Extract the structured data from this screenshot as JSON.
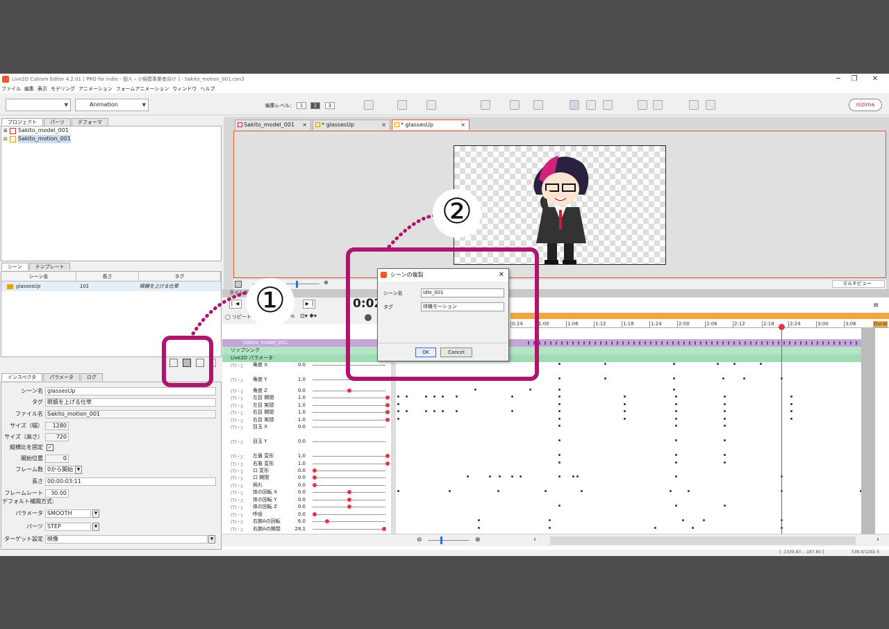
{
  "window": {
    "title": "Live2D Cubism Editor 4.2.01  [ PRO for indie - 個人・小規模事業者向け ] - Sakito_motion_001.can3",
    "min": "─",
    "max": "❐",
    "close": "✕"
  },
  "menu": [
    "ファイル",
    "編集",
    "表示",
    "モデリング",
    "アニメーション",
    "フォームアニメーション",
    "ウィンドウ",
    "ヘルプ"
  ],
  "toolbar": {
    "mode": "Animation",
    "edit_level_label": "編集レベル：",
    "levels": [
      "1",
      "2",
      "3"
    ],
    "brand": "nizima"
  },
  "project_panel": {
    "tabs": [
      "プロジェクト",
      "パーツ",
      "デフォーマ"
    ],
    "items": [
      "Sakito_model_001",
      "Sakito_motion_001"
    ]
  },
  "scene_panel": {
    "tabs": [
      "シーン",
      "テンプレート"
    ],
    "columns": [
      "シーン名",
      "長さ",
      "タグ"
    ],
    "rows": [
      {
        "name": "glassesUp",
        "length": "101",
        "tag": "眼鏡を上げる仕草"
      }
    ]
  },
  "inspector": {
    "tabs": [
      "インスペクタ",
      "パラメータ",
      "ログ"
    ],
    "scene_name_label": "シーン名",
    "scene_name": "glassesUp",
    "tag_label": "タグ",
    "tag": "眼鏡を上げる仕草",
    "file_label": "ファイル名",
    "file": "Sakito_motion_001",
    "width_label": "サイズ（幅）",
    "width": "1280",
    "height_label": "サイズ（高さ）",
    "height": "720",
    "aspect_label": "縦横比を固定",
    "start_label": "開始位置",
    "start": "0",
    "frame_label": "フレーム数",
    "frame": "0から開始",
    "length_label": "長さ",
    "length": "00:00:03:11",
    "fps_label": "フレームレート",
    "fps": "30.00",
    "interp_label": "デフォルト補間方式:",
    "param_label": "パラメータ",
    "param_interp": "SMOOTH",
    "parts_label": "パーツ",
    "parts_interp": "STEP",
    "target_label": "ターゲット設定",
    "target": "映像"
  },
  "doc_tabs": [
    {
      "label": "Sakito_model_001"
    },
    {
      "label": "* glassesUp"
    },
    {
      "label": "* glassesUp"
    }
  ],
  "canvas": {
    "view_label": "マルチビュー"
  },
  "timeline": {
    "tab": "タイムライン",
    "time": "0:02",
    "sub": "0",
    "repeat": "リピート",
    "speed": "100%",
    "ruler": [
      "0:24",
      "1:00",
      "1:06",
      "1:12",
      "1:18",
      "1:24",
      "2:00",
      "2:06",
      "2:12",
      "2:18",
      "2:24",
      "3:00",
      "3:06"
    ],
    "duration": "Durat",
    "model_row": "Sakito_model_001",
    "lipsync": "リップシンク",
    "params_row": "Live2D パラメータ",
    "params": [
      {
        "name": "角度 X",
        "value": "0.0"
      },
      {
        "name": "角度 Y",
        "value": "1.0"
      },
      {
        "name": "角度 Z",
        "value": "0.0"
      },
      {
        "name": "左目 開閉",
        "value": "1.0"
      },
      {
        "name": "左目 笑顔",
        "value": "1.0"
      },
      {
        "name": "右目 開閉",
        "value": "1.0"
      },
      {
        "name": "右目 笑顔",
        "value": "1.0"
      },
      {
        "name": "目玉 X",
        "value": "0.0"
      },
      {
        "name": "目玉 Y",
        "value": "0.0"
      },
      {
        "name": "左眉 変形",
        "value": "1.0"
      },
      {
        "name": "右眉 変形",
        "value": "1.0"
      },
      {
        "name": "口 変形",
        "value": "0.0"
      },
      {
        "name": "口 開閉",
        "value": "0.0"
      },
      {
        "name": "照れ",
        "value": "0.0"
      },
      {
        "name": "体の回転 X",
        "value": "0.0"
      },
      {
        "name": "体の回転 Y",
        "value": "0.0"
      },
      {
        "name": "体の回転 Z",
        "value": "0.0"
      },
      {
        "name": "呼吸",
        "value": "0.0"
      },
      {
        "name": "右腕Aの回転",
        "value": "6.0"
      },
      {
        "name": "右腕Aの開閉",
        "value": "28.1"
      }
    ]
  },
  "status": {
    "coords": "[ -1339.83 , -187.80 ]",
    "zoom": "539.0/1292.5"
  },
  "dialog": {
    "title": "シーンの複製",
    "name_label": "シーン名",
    "name": "Idle_001",
    "tag_label": "タグ",
    "tag": "待機モーション",
    "ok": "OK",
    "cancel": "Cancel"
  },
  "annotations": {
    "n1": "①",
    "n2": "②"
  },
  "colors": {
    "accent": "#e95b2a",
    "highlight": "#b0156e",
    "keyframe_red": "#e53345"
  }
}
